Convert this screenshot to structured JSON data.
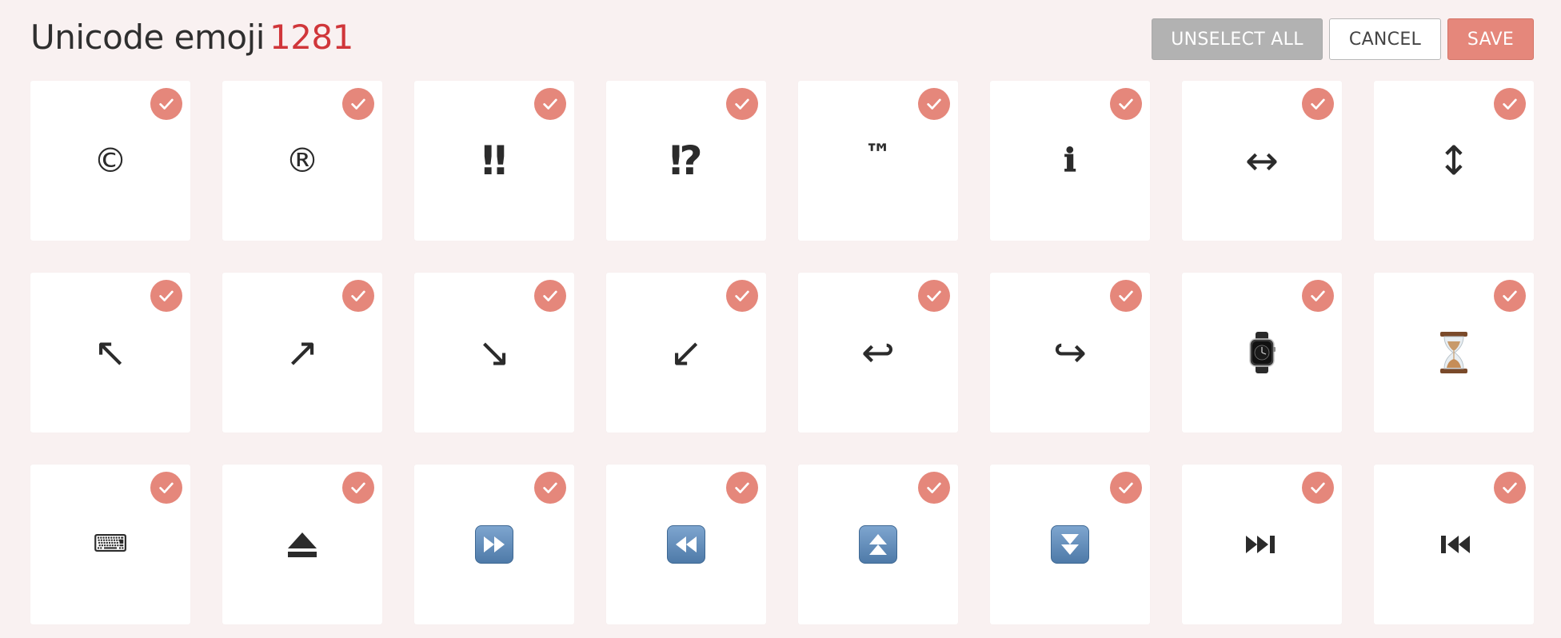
{
  "header": {
    "title": "Unicode emoji",
    "count": "1281",
    "unselect_label": "UNSELECT ALL",
    "cancel_label": "CANCEL",
    "save_label": "SAVE"
  },
  "colors": {
    "background": "#f9f1f1",
    "accent": "#e5877b",
    "count": "#d0363a",
    "unselect_bg": "#b2b2b2"
  },
  "tiles": [
    {
      "name": "copyright",
      "glyph": "©",
      "selected": true
    },
    {
      "name": "registered",
      "glyph": "®",
      "selected": true
    },
    {
      "name": "double-exclamation",
      "glyph": "‼",
      "selected": true
    },
    {
      "name": "exclamation-question",
      "glyph": "⁉",
      "selected": true
    },
    {
      "name": "trade-mark",
      "glyph": "™",
      "selected": true
    },
    {
      "name": "information",
      "glyph": "ℹ",
      "selected": true
    },
    {
      "name": "left-right-arrow",
      "glyph": "↔",
      "selected": true
    },
    {
      "name": "up-down-arrow",
      "glyph": "↕",
      "selected": true
    },
    {
      "name": "up-left-arrow",
      "glyph": "↖",
      "selected": true
    },
    {
      "name": "up-right-arrow",
      "glyph": "↗",
      "selected": true
    },
    {
      "name": "down-right-arrow",
      "glyph": "↘",
      "selected": true
    },
    {
      "name": "down-left-arrow",
      "glyph": "↙",
      "selected": true
    },
    {
      "name": "right-arrow-curving-left",
      "glyph": "↩",
      "selected": true
    },
    {
      "name": "left-arrow-curving-right",
      "glyph": "↪",
      "selected": true
    },
    {
      "name": "watch",
      "glyph": "⌚",
      "selected": true
    },
    {
      "name": "hourglass",
      "glyph": "⌛",
      "selected": true
    },
    {
      "name": "keyboard",
      "glyph": "⌨",
      "selected": true
    },
    {
      "name": "eject-button",
      "glyph": "⏏",
      "selected": true
    },
    {
      "name": "fast-forward-button",
      "glyph": "⏩",
      "selected": true
    },
    {
      "name": "fast-reverse-button",
      "glyph": "⏪",
      "selected": true
    },
    {
      "name": "fast-up-button",
      "glyph": "⏫",
      "selected": true
    },
    {
      "name": "fast-down-button",
      "glyph": "⏬",
      "selected": true
    },
    {
      "name": "next-track-button",
      "glyph": "⏭",
      "selected": true
    },
    {
      "name": "last-track-button",
      "glyph": "⏮",
      "selected": true
    }
  ]
}
